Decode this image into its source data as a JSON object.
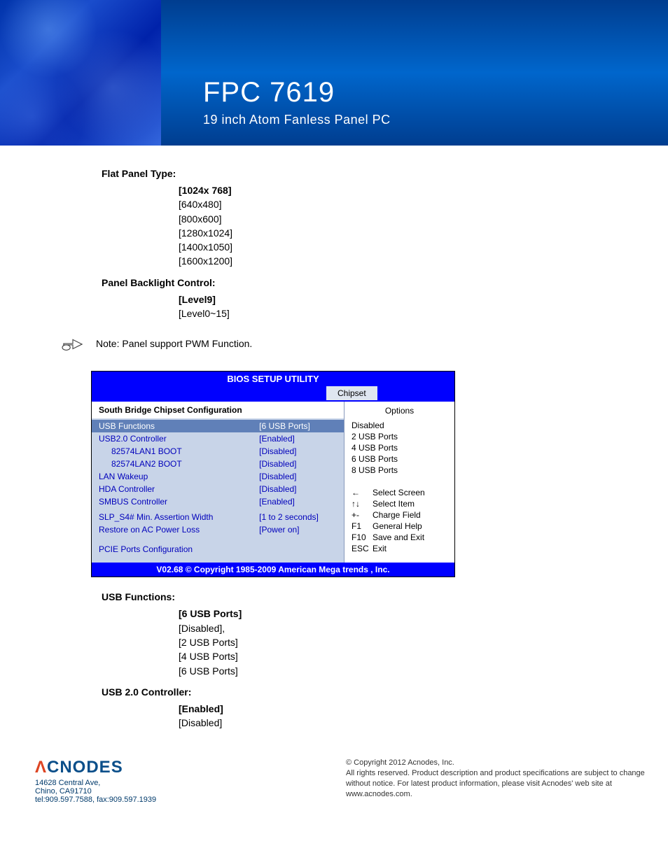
{
  "banner": {
    "title": "FPC 7619",
    "subtitle": "19 inch Atom Fanless Panel PC"
  },
  "sections": {
    "flat_panel": {
      "label": "Flat Panel Type:",
      "options": [
        "[1024x 768]",
        "[640x480]",
        "[800x600]",
        "[1280x1024]",
        "[1400x1050]",
        "[1600x1200]"
      ]
    },
    "backlight": {
      "label": "Panel Backlight Control:",
      "options": [
        "[Level9]",
        "[Level0~15]"
      ]
    },
    "note": "Note: Panel support PWM Function.",
    "usb_functions": {
      "label": "USB Functions:",
      "options": [
        "[6 USB Ports]",
        "[Disabled],",
        "[2 USB Ports]",
        "[4 USB Ports]",
        "[6 USB Ports]"
      ]
    },
    "usb_controller": {
      "label": "USB 2.0 Controller:",
      "options": [
        "[Enabled]",
        "[Disabled]"
      ]
    }
  },
  "bios": {
    "title": "BIOS SETUP UTILITY",
    "tab": "Chipset",
    "subtitle": "South Bridge Chipset Configuration",
    "rows": [
      {
        "name": "USB Functions",
        "val": "[6 USB Ports]",
        "hl": true
      },
      {
        "name": "USB2.0 Controller",
        "val": "[Enabled]"
      },
      {
        "name": "82574LAN1 BOOT",
        "val": "[Disabled]",
        "indent": true
      },
      {
        "name": "82574LAN2 BOOT",
        "val": "[Disabled]",
        "indent": true
      },
      {
        "name": "LAN Wakeup",
        "val": "[Disabled]"
      },
      {
        "name": "HDA Controller",
        "val": "[Disabled]"
      },
      {
        "name": "SMBUS Controller",
        "val": "[Enabled]"
      },
      {
        "name": "",
        "val": ""
      },
      {
        "name": "SLP_S4# Min. Assertion Width",
        "val": "[1 to 2 seconds]"
      },
      {
        "name": "Restore on AC Power Loss",
        "val": "[Power on]"
      }
    ],
    "extra_link": "PCIE Ports Configuration",
    "right_title": "Options",
    "right_options": [
      "Disabled",
      "2 USB Ports",
      "4 USB Ports",
      "6 USB Ports",
      "8 USB Ports"
    ],
    "nav": [
      {
        "key": "←",
        "label": "Select Screen"
      },
      {
        "key": "↑↓",
        "label": "Select Item"
      },
      {
        "key": "+-",
        "label": "Charge Field"
      },
      {
        "key": "F1",
        "label": "General Help"
      },
      {
        "key": "F10",
        "label": "Save and Exit"
      },
      {
        "key": "ESC",
        "label": "Exit"
      }
    ],
    "footer": "V02.68 © Copyright 1985-2009 American Mega trends , Inc."
  },
  "footer": {
    "logo": "CNODES",
    "addr1": "14628 Central Ave,",
    "addr2": "Chino, CA91710",
    "addr3": "tel:909.597.7588, fax:909.597.1939",
    "copy1": "© Copyright 2012 Acnodes, Inc.",
    "copy2": "All rights reserved. Product description and product specifications are subject to change without notice. For latest product information, please visit Acnodes' web site at www.acnodes.com."
  }
}
